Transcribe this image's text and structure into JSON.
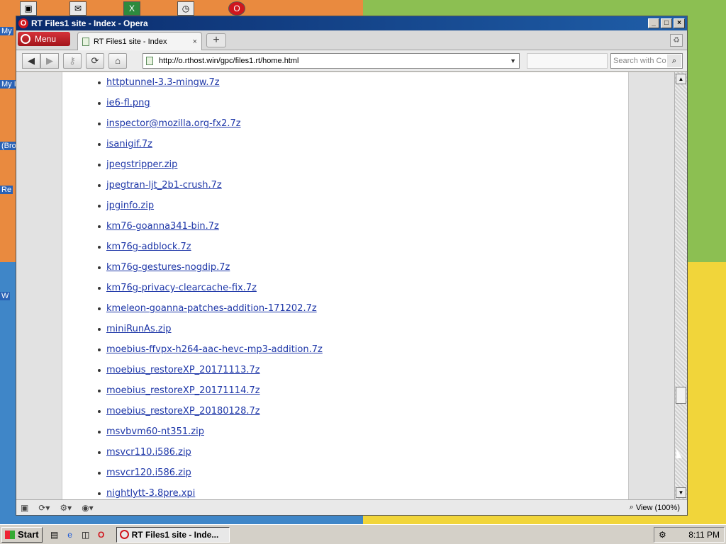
{
  "desktop": {
    "labels": [
      "My",
      "My I",
      "(Bro",
      "Re",
      "W"
    ]
  },
  "window": {
    "title": "RT Files1 site - Index - Opera",
    "minimize": "_",
    "maximize": "□",
    "close": "×"
  },
  "menu": {
    "label": "Menu"
  },
  "tab": {
    "title": "RT Files1 site - Index",
    "close": "×"
  },
  "newtab": "+",
  "address": {
    "url": "http://o.rthost.win/gpc/files1.rt/home.html"
  },
  "search": {
    "placeholder": "Search with Co"
  },
  "files": [
    "httptunnel-3.3-mingw.7z",
    "ie6-fl.png",
    "inspector@mozilla.org-fx2.7z",
    "isanigif.7z",
    "jpegstripper.zip",
    "jpegtran-ljt_2b1-crush.7z",
    "jpginfo.zip",
    "km76-goanna341-bin.7z",
    "km76g-adblock.7z",
    "km76g-gestures-nogdip.7z",
    "km76g-privacy-clearcache-fix.7z",
    "kmeleon-goanna-patches-addition-171202.7z",
    "miniRunAs.zip",
    "moebius-ffvpx-h264-aac-hevc-mp3-addition.7z",
    "moebius_restoreXP_20171113.7z",
    "moebius_restoreXP_20171114.7z",
    "moebius_restoreXP_20180128.7z",
    "msvbvm60-nt351.zip",
    "msvcr110.i586.zip",
    "msvcr120.i586.zip",
    "nightlytt-3.8pre.xpi"
  ],
  "status": {
    "zoom": "View (100%)"
  },
  "taskbar": {
    "start": "Start",
    "task_label": "RT Files1 site - Inde...",
    "clock": "8:11 PM"
  }
}
